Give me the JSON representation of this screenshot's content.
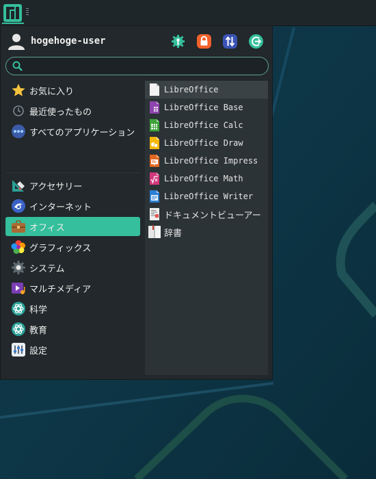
{
  "user": {
    "name": "hogehoge-user"
  },
  "search": {
    "value": "",
    "placeholder": ""
  },
  "categories": [
    {
      "label": "お気に入り",
      "icon": "star-icon"
    },
    {
      "label": "最近使ったもの",
      "icon": "clock-icon"
    },
    {
      "label": "すべてのアプリケーション",
      "icon": "dots-icon"
    },
    {
      "label": "アクセサリー",
      "icon": "accessories-icon"
    },
    {
      "label": "インターネット",
      "icon": "globe-icon"
    },
    {
      "label": "オフィス",
      "icon": "briefcase-icon",
      "selected": true
    },
    {
      "label": "グラフィックス",
      "icon": "graphics-icon"
    },
    {
      "label": "システム",
      "icon": "system-gear-icon"
    },
    {
      "label": "マルチメディア",
      "icon": "multimedia-icon"
    },
    {
      "label": "科学",
      "icon": "science-icon"
    },
    {
      "label": "教育",
      "icon": "education-icon"
    },
    {
      "label": "設定",
      "icon": "settings-icon"
    }
  ],
  "apps": [
    {
      "label": "LibreOffice",
      "icon": "libreoffice-icon",
      "color": "#f0f0f0"
    },
    {
      "label": "LibreOffice Base",
      "icon": "libreoffice-base-icon",
      "color": "#8e44ad"
    },
    {
      "label": "LibreOffice Calc",
      "icon": "libreoffice-calc-icon",
      "color": "#3fa43a"
    },
    {
      "label": "LibreOffice Draw",
      "icon": "libreoffice-draw-icon",
      "color": "#f5b80b"
    },
    {
      "label": "LibreOffice Impress",
      "icon": "libreoffice-impress-icon",
      "color": "#e0661f"
    },
    {
      "label": "LibreOffice Math",
      "icon": "libreoffice-math-icon",
      "color": "#d2387c"
    },
    {
      "label": "LibreOffice Writer",
      "icon": "libreoffice-writer-icon",
      "color": "#2a7ed3"
    },
    {
      "label": "ドキュメントビューアー",
      "icon": "document-viewer-icon",
      "color": "#e8e8e8"
    },
    {
      "label": "辞書",
      "icon": "dictionary-icon",
      "color": "#e8e8e8"
    }
  ],
  "colors": {
    "accent": "#35bf9c",
    "menu_background": "#22282b",
    "app_panel_background": "#2c3336",
    "desktop_background": "#0e3040"
  }
}
